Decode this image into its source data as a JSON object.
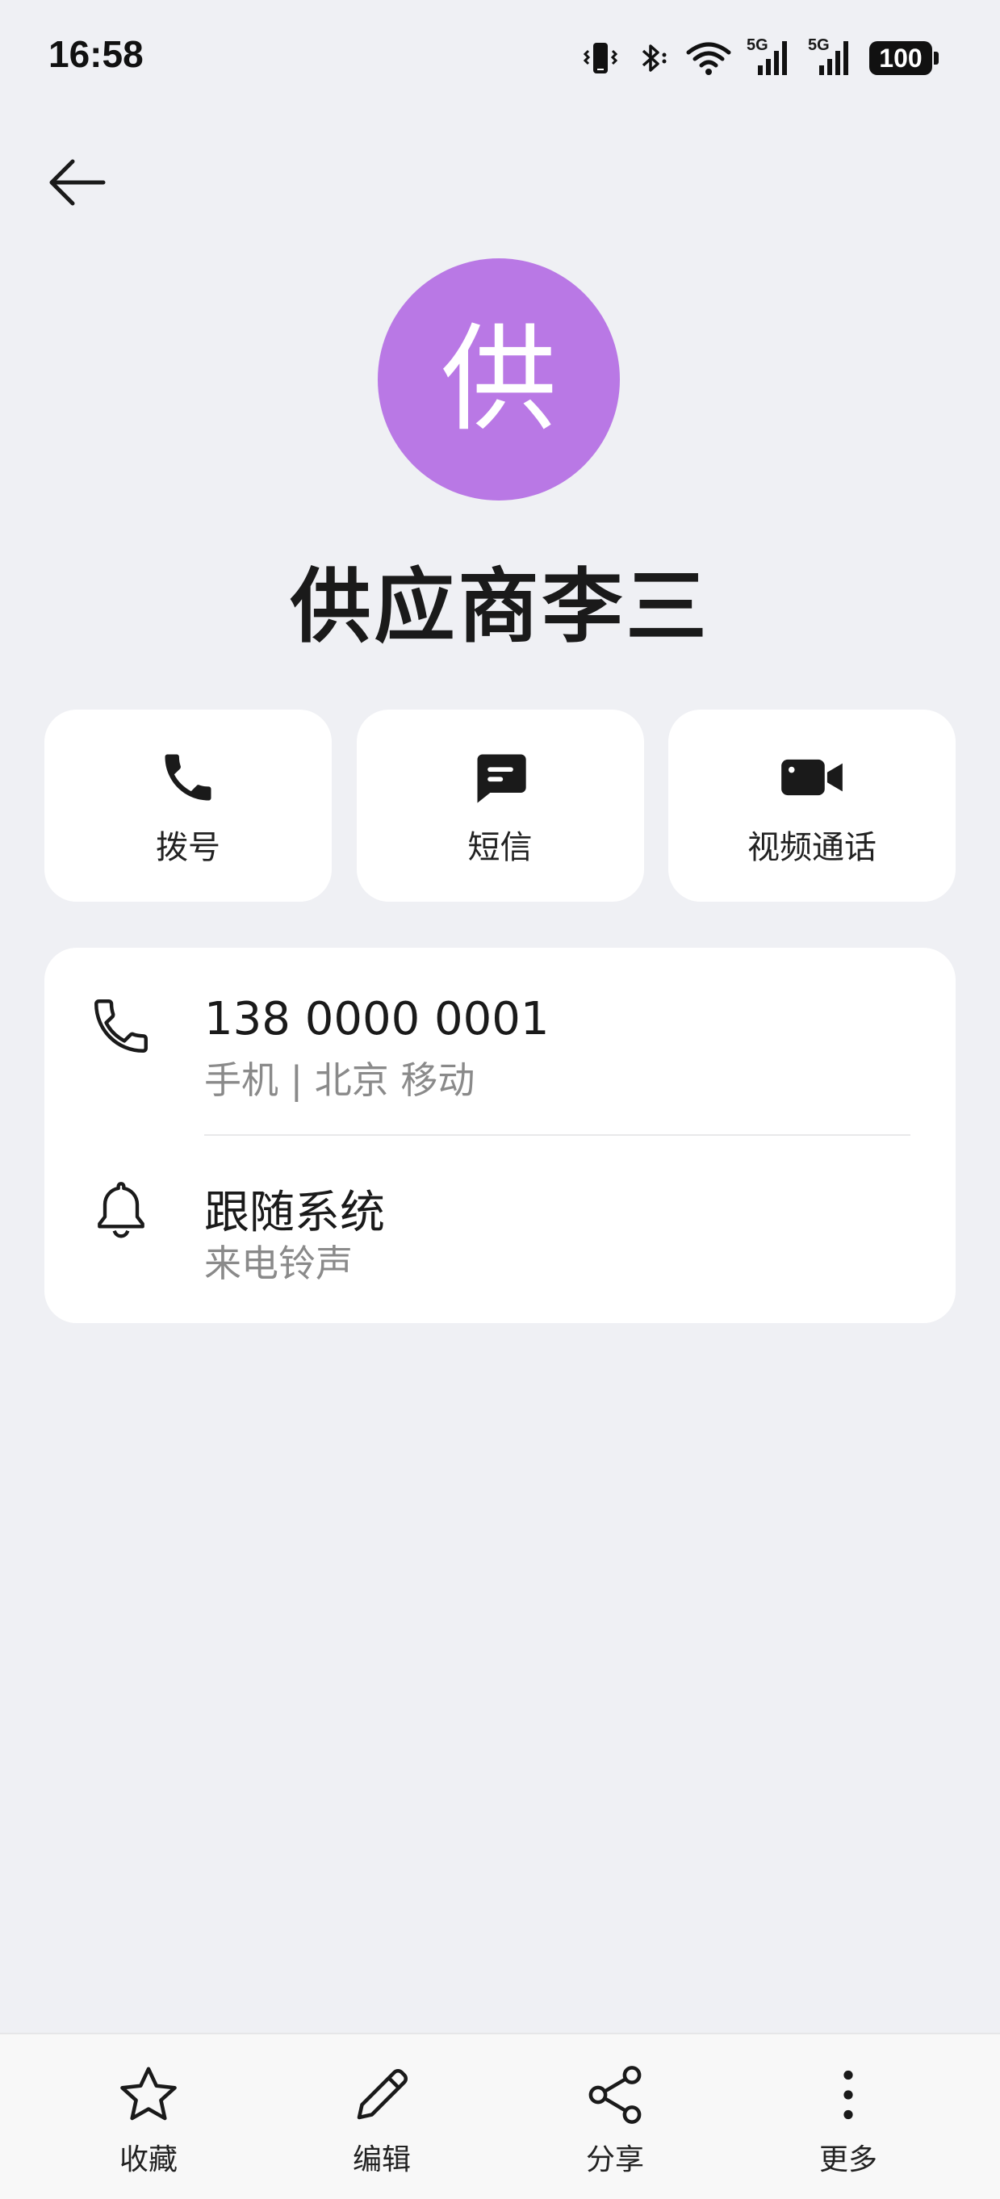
{
  "status_bar": {
    "time": "16:58",
    "battery": "100",
    "signal_1": "5G",
    "signal_2": "5G"
  },
  "contact": {
    "avatar_initial": "供",
    "avatar_color": "#b978e5",
    "name": "供应商李三"
  },
  "actions": [
    {
      "label": "拨号",
      "icon": "phone-icon"
    },
    {
      "label": "短信",
      "icon": "message-icon"
    },
    {
      "label": "视频通话",
      "icon": "video-call-icon"
    }
  ],
  "info": {
    "phone": {
      "number": "138 0000 0001",
      "detail": "手机 | 北京 移动",
      "icon": "phone-outline-icon"
    },
    "ringtone": {
      "title": "跟随系统",
      "detail": "来电铃声",
      "icon": "bell-icon"
    }
  },
  "bottom_bar": [
    {
      "label": "收藏",
      "icon": "star-icon"
    },
    {
      "label": "编辑",
      "icon": "pencil-icon"
    },
    {
      "label": "分享",
      "icon": "share-icon"
    },
    {
      "label": "更多",
      "icon": "more-vertical-icon"
    }
  ]
}
